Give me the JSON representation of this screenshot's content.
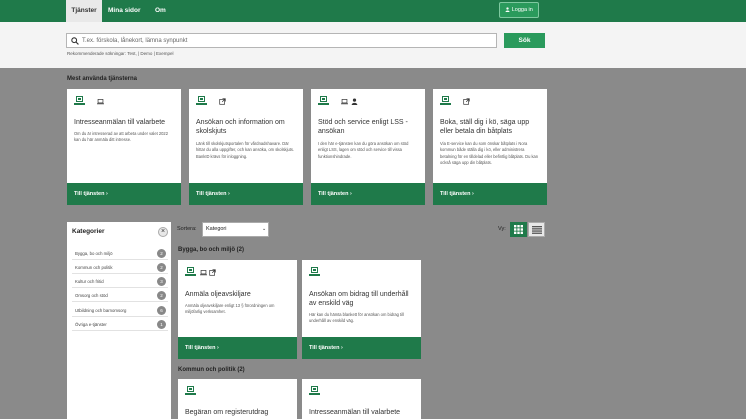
{
  "nav": {
    "tabs": [
      {
        "label": "Tjänster"
      },
      {
        "label": "Mina sidor"
      },
      {
        "label": "Om"
      }
    ],
    "login_label": "Logga in"
  },
  "search": {
    "placeholder": "T.ex. förskola, lånekort, lämna synpunkt",
    "button_label": "Sök",
    "recommended": "Rekommenderade sökningar: Test, | Demo | Exempel"
  },
  "most_used": {
    "title": "Mest använda tjänsterna",
    "cards": [
      {
        "title": "Intresseanmälan till valarbete",
        "desc": "Om du är intresserad av att arbeta under valet 2022 kan du här anmäla ditt intresse.",
        "link": "Till tjänsten ›"
      },
      {
        "title": "Ansökan och information om skolskjuts",
        "desc": "Länk till skolskjutsportalen för vårdnadshavare. Där hittar du alla uppgifter, och kan ansöka, om skolskjuts. BankID krävs för inloggning.",
        "link": "Till tjänsten ›"
      },
      {
        "title": "Stöd och service enligt LSS - ansökan",
        "desc": "I den här e-tjänsten kan du göra ansökan om stöd enligt LSS, lagen om stöd och service till vissa funktionshindrade.",
        "link": "Till tjänsten ›"
      },
      {
        "title": "Boka, ställ dig i kö, säga upp eller betala din båtplats",
        "desc": "Via E-service kan du som önskar båtplats i Nora kommun både ställa dig i kö, eller administrera betalning för en tilldelad eller befintlig båtplats. Du kan också säga upp din båtplats.",
        "link": "Till tjänsten ›"
      }
    ]
  },
  "sidebar": {
    "title": "Kategorier",
    "items": [
      {
        "label": "Bygga, bo och miljö",
        "count": "2"
      },
      {
        "label": "Kommun och politik",
        "count": "2"
      },
      {
        "label": "Kultur och fritid",
        "count": "3"
      },
      {
        "label": "Omsorg och stöd",
        "count": "2"
      },
      {
        "label": "Utbildning och barnomsorg",
        "count": "6"
      },
      {
        "label": "Övriga e-tjänster",
        "count": "1"
      }
    ]
  },
  "sort": {
    "label": "Sortera:",
    "value": "Kategori",
    "view_label": "Vy:"
  },
  "groups": [
    {
      "title": "Bygga, bo och miljö (2)",
      "cards": [
        {
          "title": "Anmäla oljeavskiljare",
          "desc": "Anmäla oljeavskiljare enligt 13 § förordningen om miljöfarlig verksamhet.",
          "link": "Till tjänsten ›"
        },
        {
          "title": "Ansökan om bidrag till underhåll av enskild väg",
          "desc": "Här kan du hämta blankett för ansökan om bidrag till underhåll av enskild väg.",
          "link": "Till tjänsten ›"
        }
      ]
    },
    {
      "title": "Kommun och politik (2)",
      "cards": [
        {
          "title": "Begäran om registerutdrag",
          "desc": "",
          "link": ""
        },
        {
          "title": "Intresseanmälan till valarbete",
          "desc": "",
          "link": ""
        }
      ]
    }
  ],
  "colors": {
    "brand": "#1f7a4a",
    "accent": "#2a9a5c",
    "backdrop": "#8a8a8a"
  }
}
